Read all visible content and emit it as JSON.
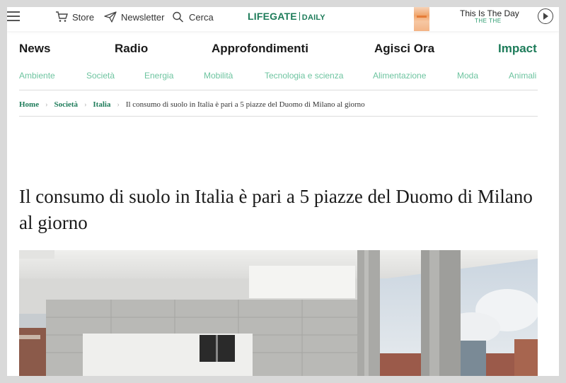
{
  "topbar": {
    "store_label": "Store",
    "newsletter_label": "Newsletter",
    "search_label": "Cerca",
    "logo_main": "LIFEGATE",
    "logo_sub": "DAILY",
    "player": {
      "song_title": "This Is The Day",
      "artist": "THE THE"
    }
  },
  "main_nav": [
    {
      "label": "News"
    },
    {
      "label": "Radio"
    },
    {
      "label": "Approfondimenti"
    },
    {
      "label": "Agisci Ora"
    },
    {
      "label": "Impact"
    }
  ],
  "sub_nav": [
    {
      "label": "Ambiente"
    },
    {
      "label": "Società"
    },
    {
      "label": "Energia"
    },
    {
      "label": "Mobilità"
    },
    {
      "label": "Tecnologia e scienza"
    },
    {
      "label": "Alimentazione"
    },
    {
      "label": "Moda"
    },
    {
      "label": "Animali"
    }
  ],
  "breadcrumb": {
    "items": [
      {
        "label": "Home"
      },
      {
        "label": "Società"
      },
      {
        "label": "Italia"
      }
    ],
    "current": "Il consumo di suolo in Italia è pari a 5 piazze del Duomo di Milano al giorno"
  },
  "article": {
    "title": "Il consumo di suolo in Italia è pari a 5 piazze del Duomo di Milano al giorno"
  },
  "colors": {
    "brand_green": "#1e7c5a",
    "subnav_green": "#6ec4a0"
  }
}
